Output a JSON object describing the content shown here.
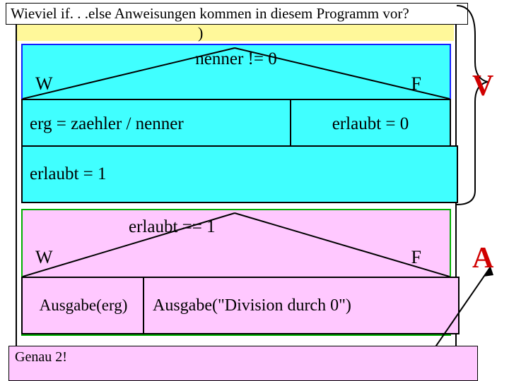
{
  "question": "Wieviel if. . .else Anweisungen kommen in diesem Programm vor?",
  "yellow_fragment": ")",
  "blue": {
    "condition": "nenner != 0",
    "true_label": "W",
    "false_label": "F",
    "true_stmt": "erg = zaehler / nenner",
    "false_stmt": "erlaubt = 0",
    "after": "erlaubt = 1"
  },
  "green": {
    "condition": "erlaubt == 1",
    "true_label": "W",
    "false_label": "F",
    "true_stmt": "Ausgabe(erg)",
    "false_stmt": "Ausgabe(\"Division durch 0\")"
  },
  "side_labels": {
    "V": "V",
    "A": "A"
  },
  "answer": "Genau 2!"
}
